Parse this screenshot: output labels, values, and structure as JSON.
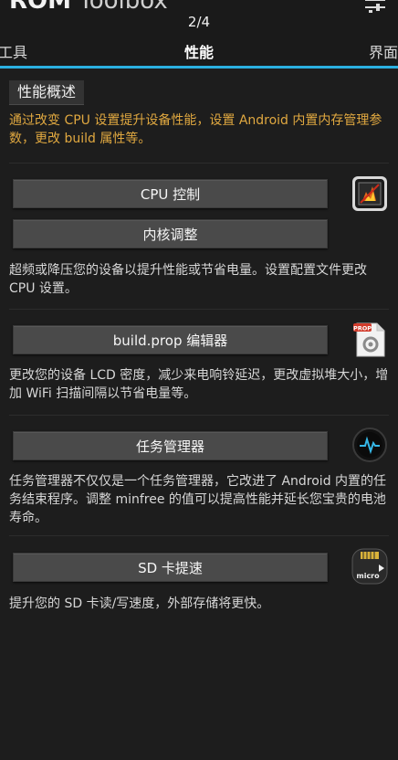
{
  "app": {
    "title_bold": "ROM",
    "title_light": "Toolbox"
  },
  "tabs": {
    "indicator": "2/4",
    "left": "工具",
    "center": "性能",
    "right": "界面"
  },
  "header": {
    "label": "性能概述",
    "intro": "通过改变 CPU 设置提升设备性能，设置 Android 内置内存管理参数，更改 build 属性等。"
  },
  "sections": [
    {
      "buttons": [
        "CPU 控制",
        "内核调整"
      ],
      "description": "超频或降压您的设备以提升性能或节省电量。设置配置文件更改 CPU 设置。",
      "icon": "cpu-chip-icon"
    },
    {
      "buttons": [
        "build.prop 编辑器"
      ],
      "description": "更改您的设备 LCD 密度，减少来电响铃延迟，更改虚拟堆大小，增加 WiFi 扫描间隔以节省电量等。",
      "icon": "prop-file-gear-icon",
      "icon_label": "PROP"
    },
    {
      "buttons": [
        "任务管理器"
      ],
      "description": "任务管理器不仅仅是一个任务管理器，它改进了 Android 内置的任务结束程序。调整 minfree 的值可以提高性能并延长您宝贵的电池寿命。",
      "icon": "task-monitor-icon"
    },
    {
      "buttons": [
        "SD 卡提速"
      ],
      "description": "提升您的 SD 卡读/写速度，外部存储将更快。",
      "icon": "microsd-card-icon",
      "icon_label": "micro"
    }
  ],
  "colors": {
    "accent": "#2bb0e0",
    "intro_text": "#e0a840",
    "button_bg": "#4a4a4a",
    "background": "#1d1d1d"
  }
}
